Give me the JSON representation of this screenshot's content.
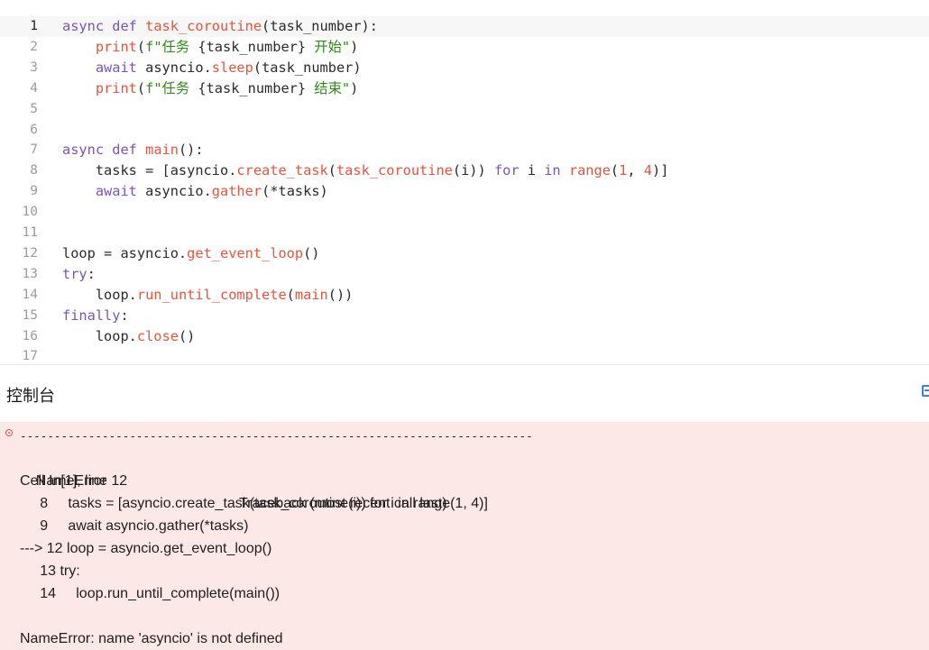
{
  "editor": {
    "lines": [
      {
        "n": "1",
        "tokens": [
          [
            "kw",
            "async def "
          ],
          [
            "fn",
            "task_coroutine"
          ],
          [
            "plain",
            "(task_number):"
          ]
        ]
      },
      {
        "n": "2",
        "tokens": [
          [
            "plain",
            "    "
          ],
          [
            "fn",
            "print"
          ],
          [
            "plain",
            "("
          ],
          [
            "str",
            "f\"任务 "
          ],
          [
            "plain",
            "{task_number}"
          ],
          [
            "str",
            " 开始\""
          ],
          [
            "plain",
            ")"
          ]
        ]
      },
      {
        "n": "3",
        "tokens": [
          [
            "plain",
            "    "
          ],
          [
            "kw",
            "await "
          ],
          [
            "plain",
            "asyncio."
          ],
          [
            "fn",
            "sleep"
          ],
          [
            "plain",
            "(task_number)"
          ]
        ]
      },
      {
        "n": "4",
        "tokens": [
          [
            "plain",
            "    "
          ],
          [
            "fn",
            "print"
          ],
          [
            "plain",
            "("
          ],
          [
            "str",
            "f\"任务 "
          ],
          [
            "plain",
            "{task_number}"
          ],
          [
            "str",
            " 结束\""
          ],
          [
            "plain",
            ")"
          ]
        ]
      },
      {
        "n": "5",
        "tokens": []
      },
      {
        "n": "6",
        "tokens": []
      },
      {
        "n": "7",
        "tokens": [
          [
            "kw",
            "async def "
          ],
          [
            "fn",
            "main"
          ],
          [
            "plain",
            "():"
          ]
        ]
      },
      {
        "n": "8",
        "tokens": [
          [
            "plain",
            "    tasks = [asyncio."
          ],
          [
            "fn",
            "create_task"
          ],
          [
            "plain",
            "("
          ],
          [
            "fn",
            "task_coroutine"
          ],
          [
            "plain",
            "(i)) "
          ],
          [
            "kw",
            "for"
          ],
          [
            "plain",
            " i "
          ],
          [
            "kw",
            "in"
          ],
          [
            "plain",
            " "
          ],
          [
            "fn",
            "range"
          ],
          [
            "plain",
            "("
          ],
          [
            "num",
            "1"
          ],
          [
            "plain",
            ", "
          ],
          [
            "num",
            "4"
          ],
          [
            "plain",
            ")]"
          ]
        ]
      },
      {
        "n": "9",
        "tokens": [
          [
            "plain",
            "    "
          ],
          [
            "kw",
            "await "
          ],
          [
            "plain",
            "asyncio."
          ],
          [
            "fn",
            "gather"
          ],
          [
            "plain",
            "(*tasks)"
          ]
        ]
      },
      {
        "n": "10",
        "tokens": []
      },
      {
        "n": "11",
        "tokens": []
      },
      {
        "n": "12",
        "tokens": [
          [
            "plain",
            "loop = asyncio."
          ],
          [
            "fn",
            "get_event_loop"
          ],
          [
            "plain",
            "()"
          ]
        ]
      },
      {
        "n": "13",
        "tokens": [
          [
            "kw",
            "try"
          ],
          [
            "plain",
            ":"
          ]
        ]
      },
      {
        "n": "14",
        "tokens": [
          [
            "plain",
            "    loop."
          ],
          [
            "fn",
            "run_until_complete"
          ],
          [
            "plain",
            "("
          ],
          [
            "fn",
            "main"
          ],
          [
            "plain",
            "())"
          ]
        ]
      },
      {
        "n": "15",
        "tokens": [
          [
            "kw",
            "finally"
          ],
          [
            "plain",
            ":"
          ]
        ]
      },
      {
        "n": "16",
        "tokens": [
          [
            "plain",
            "    loop."
          ],
          [
            "fn",
            "close"
          ],
          [
            "plain",
            "()"
          ]
        ]
      },
      {
        "n": "17",
        "tokens": []
      }
    ]
  },
  "console": {
    "title": "控制台",
    "dashes": "---------------------------------------------------------------------------",
    "error_type": "NameError",
    "traceback_label": "Traceback (most recent call last)",
    "cell_info": "Cell In[1], line 12",
    "trace_lines": [
      "     8     tasks = [asyncio.create_task(task_coroutine(i)) for i in range(1, 4)]",
      "     9     await asyncio.gather(*tasks)",
      "---> 12 loop = asyncio.get_event_loop()",
      "     13 try:",
      "     14     loop.run_until_complete(main())"
    ],
    "error_message": "NameError: name 'asyncio' is not defined"
  },
  "colors": {
    "keyword": "#7a55b5",
    "function": "#e4553d",
    "string": "#2f8a16",
    "error_background": "#fde8e8"
  }
}
